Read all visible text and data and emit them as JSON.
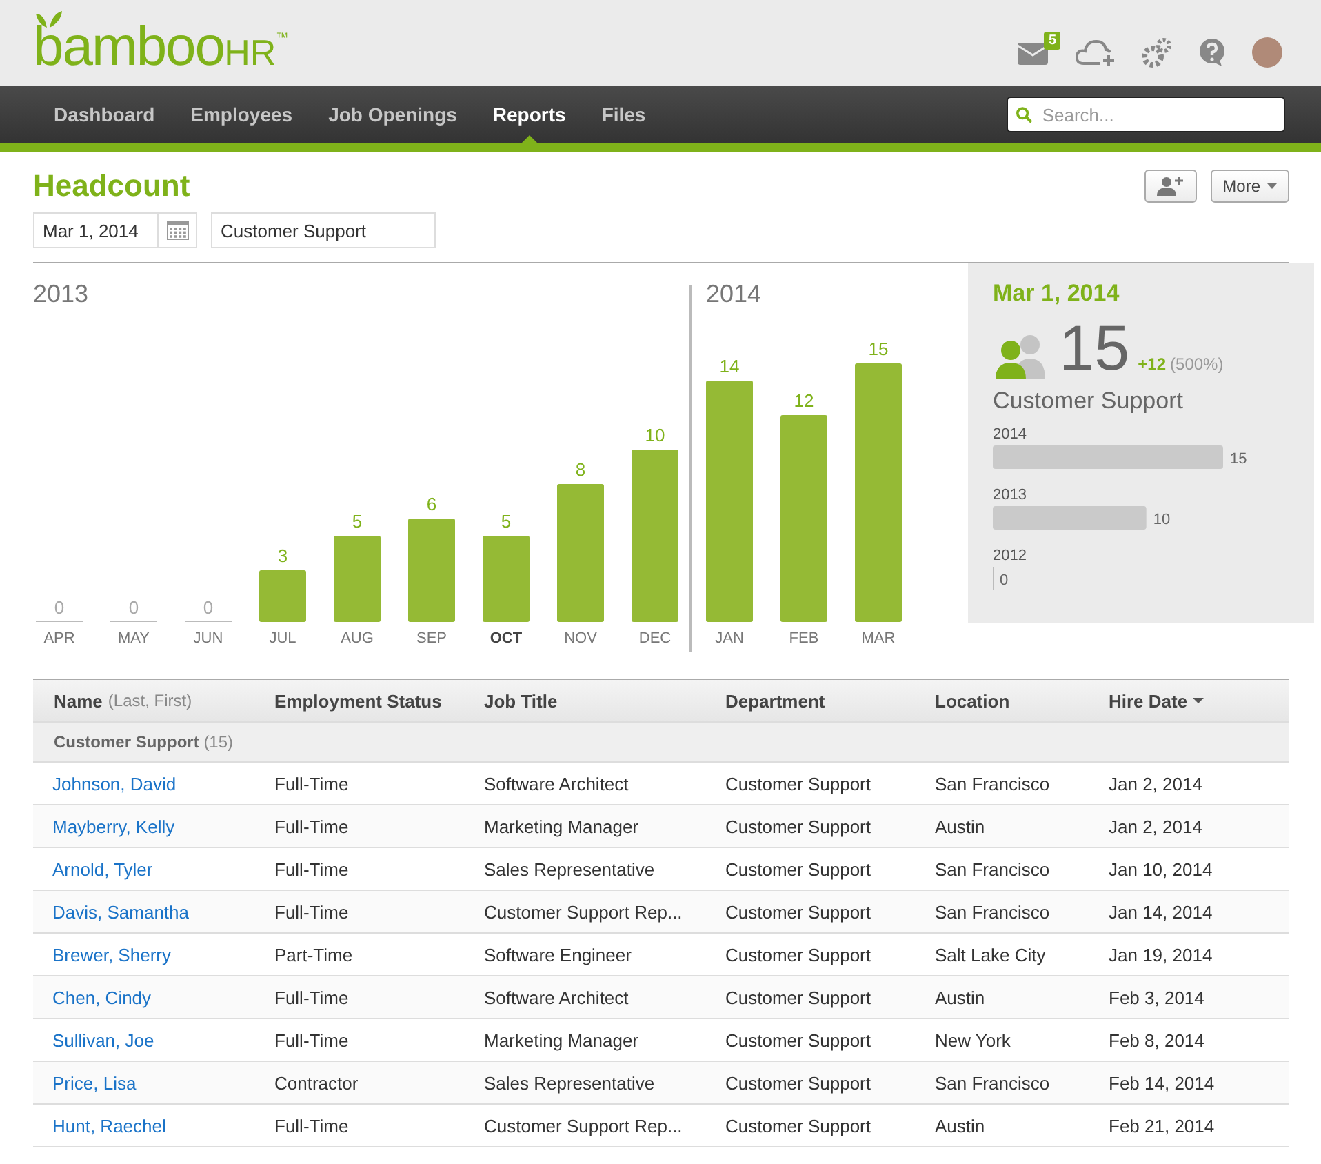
{
  "header": {
    "logo": {
      "main": "bamboo",
      "suffix": "HR",
      "mark": "™"
    },
    "mail_badge": "5"
  },
  "nav": {
    "items": [
      {
        "label": "Dashboard",
        "selected": false
      },
      {
        "label": "Employees",
        "selected": false
      },
      {
        "label": "Job Openings",
        "selected": false
      },
      {
        "label": "Reports",
        "selected": true
      },
      {
        "label": "Files",
        "selected": false
      }
    ],
    "search": {
      "placeholder": "Search..."
    }
  },
  "page": {
    "title": "Headcount",
    "date_field": "Mar 1, 2014",
    "department_field": "Customer Support",
    "more_button": "More"
  },
  "chart": {
    "year_labels": [
      "2013",
      "2014"
    ],
    "bold_categories": [
      false,
      false,
      false,
      false,
      false,
      false,
      true,
      false,
      false,
      false,
      false,
      false
    ],
    "chart_data": {
      "type": "bar",
      "categories": [
        "APR",
        "MAY",
        "JUN",
        "JUL",
        "AUG",
        "SEP",
        "OCT",
        "NOV",
        "DEC",
        "JAN",
        "FEB",
        "MAR"
      ],
      "values": [
        0,
        0,
        0,
        3,
        5,
        6,
        5,
        8,
        10,
        14,
        12,
        15
      ],
      "data_labels": true
    }
  },
  "summary": {
    "date": "Mar 1, 2014",
    "count": "15",
    "change": "+12",
    "percent": "(500%)",
    "department": "Customer Support",
    "chart_data": {
      "type": "bar",
      "orientation": "horizontal",
      "categories": [
        "2014",
        "2013",
        "2012"
      ],
      "values": [
        15,
        10,
        0
      ],
      "data_labels": true
    }
  },
  "table": {
    "columns": [
      {
        "label": "Name",
        "note": "(Last, First)",
        "sorted": false
      },
      {
        "label": "Employment Status",
        "sorted": false
      },
      {
        "label": "Job Title",
        "sorted": false
      },
      {
        "label": "Department",
        "sorted": false
      },
      {
        "label": "Location",
        "sorted": false
      },
      {
        "label": "Hire Date",
        "sorted": true
      }
    ],
    "group": {
      "label": "Customer Support",
      "count": "(15)"
    },
    "rows": [
      [
        "Johnson, David",
        "Full-Time",
        "Software Architect",
        "Customer Support",
        "San Francisco",
        "Jan 2, 2014"
      ],
      [
        "Mayberry, Kelly",
        "Full-Time",
        "Marketing Manager",
        "Customer Support",
        "Austin",
        "Jan 2, 2014"
      ],
      [
        "Arnold, Tyler",
        "Full-Time",
        "Sales Representative",
        "Customer Support",
        "San Francisco",
        "Jan 10, 2014"
      ],
      [
        "Davis, Samantha",
        "Full-Time",
        "Customer Support Rep...",
        "Customer Support",
        "San Francisco",
        "Jan 14, 2014"
      ],
      [
        "Brewer, Sherry",
        "Part-Time",
        "Software Engineer",
        "Customer Support",
        "Salt Lake City",
        "Jan 19, 2014"
      ],
      [
        "Chen, Cindy",
        "Full-Time",
        "Software Architect",
        "Customer Support",
        "Austin",
        "Feb 3, 2014"
      ],
      [
        "Sullivan, Joe",
        "Full-Time",
        "Marketing Manager",
        "Customer Support",
        "New York",
        "Feb 8, 2014"
      ],
      [
        "Price, Lisa",
        "Contractor",
        "Sales Representative",
        "Customer Support",
        "San Francisco",
        "Feb 14, 2014"
      ],
      [
        "Hunt, Raechel",
        "Full-Time",
        "Customer Support Rep...",
        "Customer Support",
        "Austin",
        "Feb 21, 2014"
      ]
    ]
  }
}
